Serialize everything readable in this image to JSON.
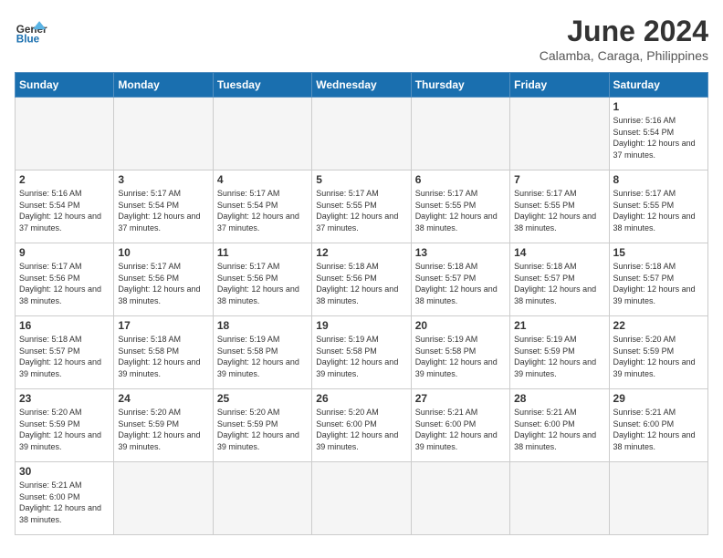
{
  "header": {
    "logo_general": "General",
    "logo_blue": "Blue",
    "month_title": "June 2024",
    "location": "Calamba, Caraga, Philippines"
  },
  "weekdays": [
    "Sunday",
    "Monday",
    "Tuesday",
    "Wednesday",
    "Thursday",
    "Friday",
    "Saturday"
  ],
  "days": [
    {
      "num": "",
      "empty": true,
      "sunrise": "",
      "sunset": "",
      "daylight": ""
    },
    {
      "num": "",
      "empty": true,
      "sunrise": "",
      "sunset": "",
      "daylight": ""
    },
    {
      "num": "",
      "empty": true,
      "sunrise": "",
      "sunset": "",
      "daylight": ""
    },
    {
      "num": "",
      "empty": true,
      "sunrise": "",
      "sunset": "",
      "daylight": ""
    },
    {
      "num": "",
      "empty": true,
      "sunrise": "",
      "sunset": "",
      "daylight": ""
    },
    {
      "num": "",
      "empty": true,
      "sunrise": "",
      "sunset": "",
      "daylight": ""
    },
    {
      "num": "1",
      "empty": false,
      "sunrise": "Sunrise: 5:16 AM",
      "sunset": "Sunset: 5:54 PM",
      "daylight": "Daylight: 12 hours and 37 minutes."
    },
    {
      "num": "2",
      "empty": false,
      "sunrise": "Sunrise: 5:16 AM",
      "sunset": "Sunset: 5:54 PM",
      "daylight": "Daylight: 12 hours and 37 minutes."
    },
    {
      "num": "3",
      "empty": false,
      "sunrise": "Sunrise: 5:17 AM",
      "sunset": "Sunset: 5:54 PM",
      "daylight": "Daylight: 12 hours and 37 minutes."
    },
    {
      "num": "4",
      "empty": false,
      "sunrise": "Sunrise: 5:17 AM",
      "sunset": "Sunset: 5:54 PM",
      "daylight": "Daylight: 12 hours and 37 minutes."
    },
    {
      "num": "5",
      "empty": false,
      "sunrise": "Sunrise: 5:17 AM",
      "sunset": "Sunset: 5:55 PM",
      "daylight": "Daylight: 12 hours and 37 minutes."
    },
    {
      "num": "6",
      "empty": false,
      "sunrise": "Sunrise: 5:17 AM",
      "sunset": "Sunset: 5:55 PM",
      "daylight": "Daylight: 12 hours and 38 minutes."
    },
    {
      "num": "7",
      "empty": false,
      "sunrise": "Sunrise: 5:17 AM",
      "sunset": "Sunset: 5:55 PM",
      "daylight": "Daylight: 12 hours and 38 minutes."
    },
    {
      "num": "8",
      "empty": false,
      "sunrise": "Sunrise: 5:17 AM",
      "sunset": "Sunset: 5:55 PM",
      "daylight": "Daylight: 12 hours and 38 minutes."
    },
    {
      "num": "9",
      "empty": false,
      "sunrise": "Sunrise: 5:17 AM",
      "sunset": "Sunset: 5:56 PM",
      "daylight": "Daylight: 12 hours and 38 minutes."
    },
    {
      "num": "10",
      "empty": false,
      "sunrise": "Sunrise: 5:17 AM",
      "sunset": "Sunset: 5:56 PM",
      "daylight": "Daylight: 12 hours and 38 minutes."
    },
    {
      "num": "11",
      "empty": false,
      "sunrise": "Sunrise: 5:17 AM",
      "sunset": "Sunset: 5:56 PM",
      "daylight": "Daylight: 12 hours and 38 minutes."
    },
    {
      "num": "12",
      "empty": false,
      "sunrise": "Sunrise: 5:18 AM",
      "sunset": "Sunset: 5:56 PM",
      "daylight": "Daylight: 12 hours and 38 minutes."
    },
    {
      "num": "13",
      "empty": false,
      "sunrise": "Sunrise: 5:18 AM",
      "sunset": "Sunset: 5:57 PM",
      "daylight": "Daylight: 12 hours and 38 minutes."
    },
    {
      "num": "14",
      "empty": false,
      "sunrise": "Sunrise: 5:18 AM",
      "sunset": "Sunset: 5:57 PM",
      "daylight": "Daylight: 12 hours and 38 minutes."
    },
    {
      "num": "15",
      "empty": false,
      "sunrise": "Sunrise: 5:18 AM",
      "sunset": "Sunset: 5:57 PM",
      "daylight": "Daylight: 12 hours and 39 minutes."
    },
    {
      "num": "16",
      "empty": false,
      "sunrise": "Sunrise: 5:18 AM",
      "sunset": "Sunset: 5:57 PM",
      "daylight": "Daylight: 12 hours and 39 minutes."
    },
    {
      "num": "17",
      "empty": false,
      "sunrise": "Sunrise: 5:18 AM",
      "sunset": "Sunset: 5:58 PM",
      "daylight": "Daylight: 12 hours and 39 minutes."
    },
    {
      "num": "18",
      "empty": false,
      "sunrise": "Sunrise: 5:19 AM",
      "sunset": "Sunset: 5:58 PM",
      "daylight": "Daylight: 12 hours and 39 minutes."
    },
    {
      "num": "19",
      "empty": false,
      "sunrise": "Sunrise: 5:19 AM",
      "sunset": "Sunset: 5:58 PM",
      "daylight": "Daylight: 12 hours and 39 minutes."
    },
    {
      "num": "20",
      "empty": false,
      "sunrise": "Sunrise: 5:19 AM",
      "sunset": "Sunset: 5:58 PM",
      "daylight": "Daylight: 12 hours and 39 minutes."
    },
    {
      "num": "21",
      "empty": false,
      "sunrise": "Sunrise: 5:19 AM",
      "sunset": "Sunset: 5:59 PM",
      "daylight": "Daylight: 12 hours and 39 minutes."
    },
    {
      "num": "22",
      "empty": false,
      "sunrise": "Sunrise: 5:20 AM",
      "sunset": "Sunset: 5:59 PM",
      "daylight": "Daylight: 12 hours and 39 minutes."
    },
    {
      "num": "23",
      "empty": false,
      "sunrise": "Sunrise: 5:20 AM",
      "sunset": "Sunset: 5:59 PM",
      "daylight": "Daylight: 12 hours and 39 minutes."
    },
    {
      "num": "24",
      "empty": false,
      "sunrise": "Sunrise: 5:20 AM",
      "sunset": "Sunset: 5:59 PM",
      "daylight": "Daylight: 12 hours and 39 minutes."
    },
    {
      "num": "25",
      "empty": false,
      "sunrise": "Sunrise: 5:20 AM",
      "sunset": "Sunset: 5:59 PM",
      "daylight": "Daylight: 12 hours and 39 minutes."
    },
    {
      "num": "26",
      "empty": false,
      "sunrise": "Sunrise: 5:20 AM",
      "sunset": "Sunset: 6:00 PM",
      "daylight": "Daylight: 12 hours and 39 minutes."
    },
    {
      "num": "27",
      "empty": false,
      "sunrise": "Sunrise: 5:21 AM",
      "sunset": "Sunset: 6:00 PM",
      "daylight": "Daylight: 12 hours and 39 minutes."
    },
    {
      "num": "28",
      "empty": false,
      "sunrise": "Sunrise: 5:21 AM",
      "sunset": "Sunset: 6:00 PM",
      "daylight": "Daylight: 12 hours and 38 minutes."
    },
    {
      "num": "29",
      "empty": false,
      "sunrise": "Sunrise: 5:21 AM",
      "sunset": "Sunset: 6:00 PM",
      "daylight": "Daylight: 12 hours and 38 minutes."
    },
    {
      "num": "30",
      "empty": false,
      "sunrise": "Sunrise: 5:21 AM",
      "sunset": "Sunset: 6:00 PM",
      "daylight": "Daylight: 12 hours and 38 minutes."
    }
  ]
}
